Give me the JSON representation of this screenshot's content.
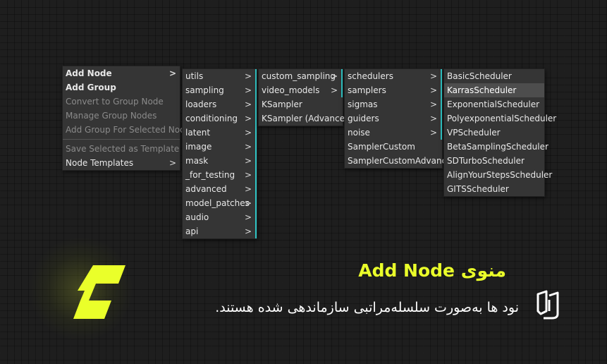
{
  "menus": {
    "root": [
      {
        "label": "Add Node",
        "arrow": ">",
        "style": "bold"
      },
      {
        "label": "Add Group",
        "arrow": "",
        "style": "bold"
      },
      {
        "label": "Convert to Group Node",
        "arrow": "",
        "style": "disabled"
      },
      {
        "label": "Manage Group Nodes",
        "arrow": "",
        "style": "disabled"
      },
      {
        "label": "Add Group For Selected Nodes",
        "arrow": "",
        "style": "disabled"
      },
      {
        "separator": true
      },
      {
        "label": "Save Selected as Template",
        "arrow": "",
        "style": "disabled"
      },
      {
        "label": "Node Templates",
        "arrow": ">",
        "style": "normal"
      }
    ],
    "categories": [
      {
        "label": "utils",
        "arrow": ">"
      },
      {
        "label": "sampling",
        "arrow": ">"
      },
      {
        "label": "loaders",
        "arrow": ">"
      },
      {
        "label": "conditioning",
        "arrow": ">"
      },
      {
        "label": "latent",
        "arrow": ">"
      },
      {
        "label": "image",
        "arrow": ">"
      },
      {
        "label": "mask",
        "arrow": ">"
      },
      {
        "label": "_for_testing",
        "arrow": ">"
      },
      {
        "label": "advanced",
        "arrow": ">"
      },
      {
        "label": "model_patches",
        "arrow": ">"
      },
      {
        "label": "audio",
        "arrow": ">"
      },
      {
        "label": "api",
        "arrow": ">"
      }
    ],
    "sampling": [
      {
        "label": "custom_sampling",
        "arrow": ">"
      },
      {
        "label": "video_models",
        "arrow": ">"
      },
      {
        "label": "KSampler",
        "arrow": ""
      },
      {
        "label": "KSampler (Advanced)",
        "arrow": ""
      }
    ],
    "custom_sampling": [
      {
        "label": "schedulers",
        "arrow": ">"
      },
      {
        "label": "samplers",
        "arrow": ">"
      },
      {
        "label": "sigmas",
        "arrow": ">"
      },
      {
        "label": "guiders",
        "arrow": ">"
      },
      {
        "label": "noise",
        "arrow": ">"
      },
      {
        "label": "SamplerCustom",
        "arrow": ""
      },
      {
        "label": "SamplerCustomAdvanced",
        "arrow": ""
      }
    ],
    "schedulers": [
      {
        "label": "BasicScheduler",
        "highlighted": false
      },
      {
        "label": "KarrasScheduler",
        "highlighted": true
      },
      {
        "label": "ExponentialScheduler",
        "highlighted": false
      },
      {
        "label": "PolyexponentialScheduler",
        "highlighted": false
      },
      {
        "label": "VPScheduler",
        "highlighted": false
      },
      {
        "label": "BetaSamplingScheduler",
        "highlighted": false
      },
      {
        "label": "SDTurboScheduler",
        "highlighted": false
      },
      {
        "label": "AlignYourStepsScheduler",
        "highlighted": false
      },
      {
        "label": "GITSScheduler",
        "highlighted": false
      }
    ]
  },
  "caption": {
    "title": "منوی Add Node",
    "subtitle": "نود ها به‌صورت سلسله‌مراتبی سازماندهی شده هستند."
  },
  "colors": {
    "accent_yellow": "#eaff2a",
    "submenu_marker": "#2ec4c4",
    "menu_bg": "#353535",
    "highlight_bg": "#4d4d4d"
  },
  "icons": {
    "left_logo": "stylized-c-logo-icon",
    "right_logo": "brand-mark-icon"
  }
}
